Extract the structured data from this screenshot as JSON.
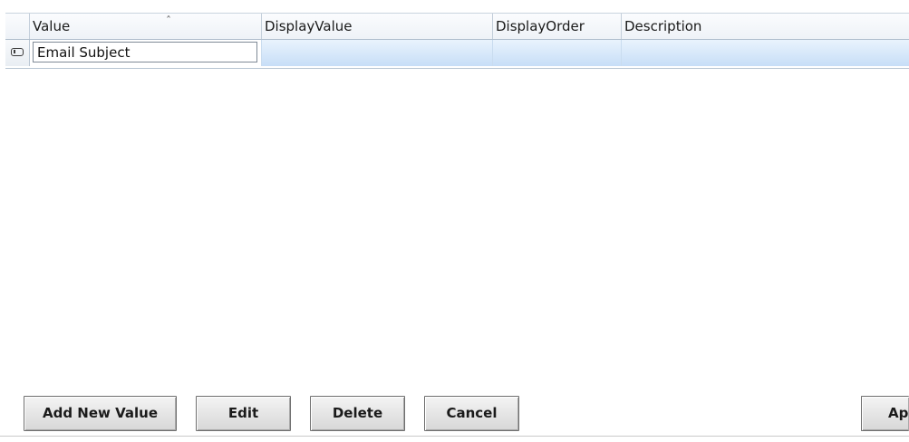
{
  "grid": {
    "columns": [
      {
        "label": "Value",
        "sorted": "ascending"
      },
      {
        "label": "DisplayValue"
      },
      {
        "label": "DisplayOrder"
      },
      {
        "label": "Description"
      }
    ],
    "rows": [
      {
        "value": "Email Subject",
        "display_value": "",
        "display_order": "",
        "description": ""
      }
    ],
    "sort_icon": "sort-ascending-icon",
    "row_state_icon": "row-editing-icon"
  },
  "buttons": {
    "add_new_value": "Add New Value",
    "edit": "Edit",
    "delete": "Delete",
    "cancel": "Cancel",
    "apply": "Ap"
  },
  "colors": {
    "row_highlight": "#c7def7",
    "header_bg": "#eef2f7"
  }
}
